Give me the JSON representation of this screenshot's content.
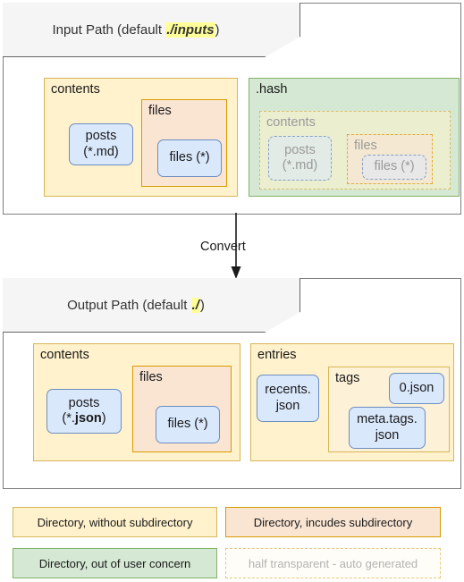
{
  "diagram": {
    "title_input": {
      "prefix": "Input Path (default ",
      "highlight": "./inputs",
      "suffix": ")"
    },
    "title_output": {
      "prefix": "Output Path (default ",
      "highlight": "./",
      "suffix": ")"
    },
    "connector_label": "Convert",
    "input_section": {
      "contents_dir": {
        "label": "contents",
        "posts_node": "posts\n(*.md)",
        "posts_node_line1": "posts",
        "posts_node_line2": "(*.md)",
        "files_dir": {
          "label": "files",
          "files_node": "files (*)"
        }
      },
      "hash_dir": {
        "label": ".hash",
        "contents_dir": {
          "label": "contents",
          "posts_node_line1": "posts",
          "posts_node_line2": "(*.md)",
          "files_dir": {
            "label": "files",
            "files_node": "files (*)"
          }
        }
      }
    },
    "output_section": {
      "contents_dir": {
        "label": "contents",
        "posts_node_line1": "posts",
        "posts_node_prefix": "(*.",
        "posts_node_bold": "json",
        "posts_node_suffix": ")",
        "files_dir": {
          "label": "files",
          "files_node": "files (*)"
        }
      },
      "entries_dir": {
        "label": "entries",
        "recents_node_line1": "recents.",
        "recents_node_line2": "json",
        "tags_dir": {
          "label": "tags",
          "zero_node": "0.json",
          "meta_node_line1": "meta.tags.",
          "meta_node_line2": "json"
        }
      }
    },
    "legend": [
      {
        "text": "Directory, without subdirectory",
        "style": "yellow"
      },
      {
        "text": "Directory, incudes subdirectory",
        "style": "orange"
      },
      {
        "text": "Directory, out of user concern",
        "style": "green"
      },
      {
        "text": "half transparent - auto generated",
        "style": "dashed"
      }
    ],
    "colors": {
      "yellow_fill": "#fff2cc",
      "yellow_border": "#d6b656",
      "orange_fill": "#fae5d3",
      "orange_border": "#d79b00",
      "green_fill": "#d5e8d4",
      "green_border": "#82b366",
      "blue_fill": "#dae8fc",
      "blue_border": "#6c8ebf",
      "highlight": "#ffff99",
      "panel_border": "#808080",
      "tab_fill": "#f5f5f5"
    }
  }
}
